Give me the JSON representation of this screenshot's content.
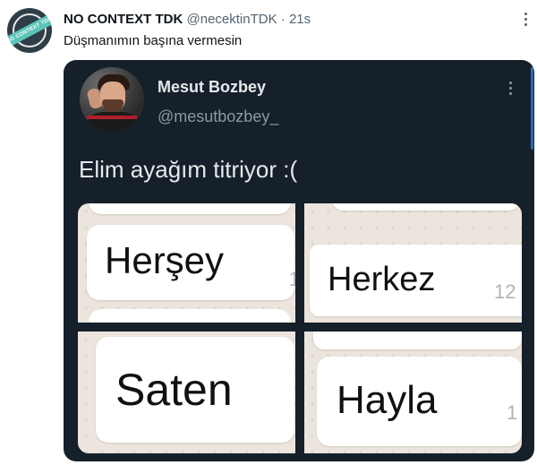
{
  "tweet": {
    "author_name": "NO CONTEXT TDK",
    "author_handle": "@necektinTDK",
    "separator": "·",
    "time": "21s",
    "text": "Düşmanımın başına vermesin",
    "avatar_logo_text": "NO CONTEXT TDK",
    "more_icon": "more-horizontal-icon"
  },
  "quoted_tweet": {
    "author_name": "Mesut Bozbey",
    "author_handle": "@mesutbozbey_",
    "text": "Elim ayağım titriyor :(",
    "more_icon": "more-vertical-icon"
  },
  "images": [
    {
      "word": "Herşey",
      "number": "1"
    },
    {
      "word": "Herkez",
      "number": "12"
    },
    {
      "word": "Saten",
      "number": ""
    },
    {
      "word": "Hayla",
      "number": "1"
    }
  ],
  "colors": {
    "card_background": "#15202b",
    "chat_background": "#ece5dd",
    "bubble": "#ffffff",
    "avatar_band": "#59c5b8",
    "scroll_accent": "#2c6cb3"
  }
}
